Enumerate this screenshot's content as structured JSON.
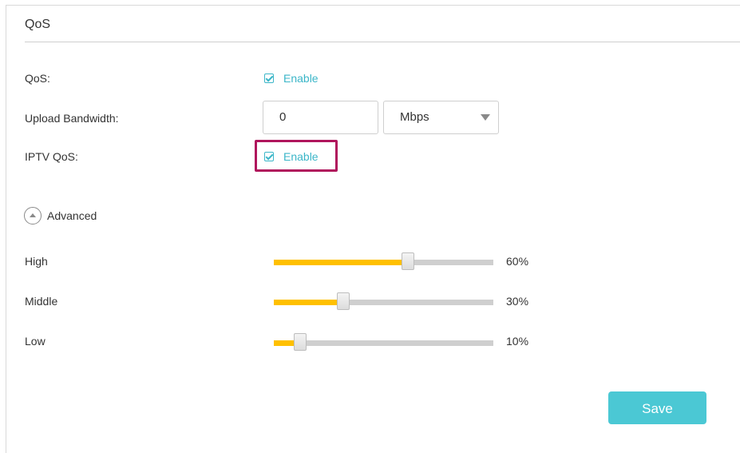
{
  "header": {
    "title": "QoS"
  },
  "qos": {
    "label": "QoS:",
    "enable_text": "Enable",
    "checked": true
  },
  "upload": {
    "label": "Upload Bandwidth:",
    "value": "0",
    "unit": "Mbps"
  },
  "iptv": {
    "label": "IPTV QoS:",
    "enable_text": "Enable",
    "checked": true
  },
  "advanced": {
    "label": "Advanced",
    "icon": "chevron-up-circle-icon"
  },
  "priorities": [
    {
      "label": "High",
      "percent_text": "60%",
      "fill": 0.6
    },
    {
      "label": "Middle",
      "percent_text": "30%",
      "fill": 0.3
    },
    {
      "label": "Low",
      "percent_text": "10%",
      "fill": 0.1
    }
  ],
  "actions": {
    "save_label": "Save"
  },
  "colors": {
    "accent": "#3bb6c8",
    "slider": "#ffc000",
    "highlight": "#b0155c",
    "save": "#4bc8d4"
  }
}
